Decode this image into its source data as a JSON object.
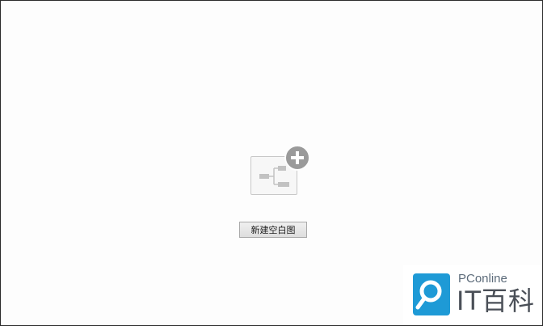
{
  "empty_state": {
    "tile_icon": "mindmap-icon",
    "add_icon": "plus-circle-icon",
    "new_blank_label": "新建空白图"
  },
  "watermark": {
    "logo_icon": "magnifier-logo-icon",
    "brand": "PConline",
    "title": "IT百科"
  },
  "colors": {
    "icon_gray": "#bdbdbd",
    "badge_gray": "#9a9a9a",
    "logo_blue": "#1e9ad6"
  }
}
